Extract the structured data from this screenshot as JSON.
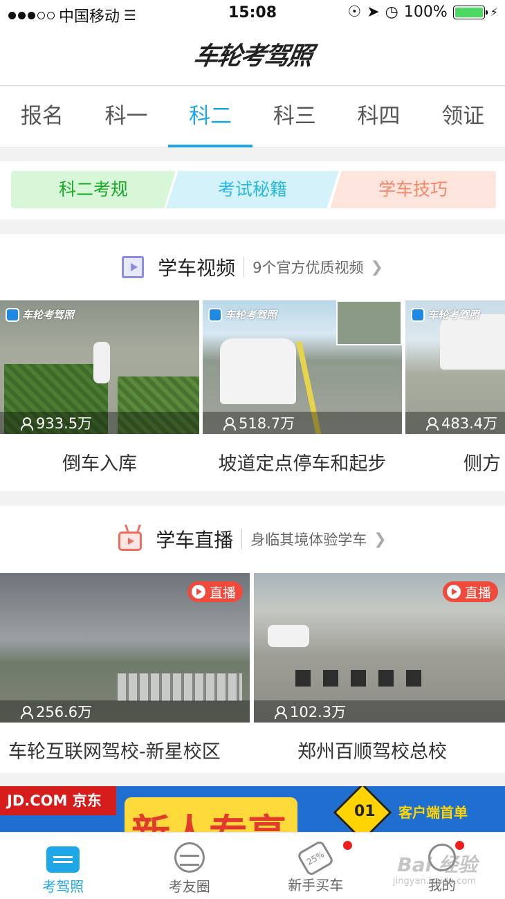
{
  "status_bar": {
    "carrier": "中国移动",
    "time": "15:08",
    "battery": "100%"
  },
  "header": {
    "logo": "车轮考驾照"
  },
  "tabs": [
    {
      "label": "报名"
    },
    {
      "label": "科一"
    },
    {
      "label": "科二",
      "active": true
    },
    {
      "label": "科三"
    },
    {
      "label": "科四"
    },
    {
      "label": "领证"
    }
  ],
  "categories": [
    {
      "label": "科二考规",
      "color": "#1aaa2a"
    },
    {
      "label": "考试秘籍",
      "color": "#2bb8e0"
    },
    {
      "label": "学车技巧",
      "color": "#f08a6a"
    }
  ],
  "video_section": {
    "title": "学车视频",
    "subtitle": "9个官方优质视频",
    "brand_mark": "车轮考驾照",
    "videos": [
      {
        "views": "933.5万",
        "caption": "倒车入库"
      },
      {
        "views": "518.7万",
        "caption": "坡道定点停车和起步"
      },
      {
        "views": "483.4万",
        "caption": "侧方"
      }
    ]
  },
  "live_section": {
    "title": "学车直播",
    "subtitle": "身临其境体验学车",
    "badge": "直播",
    "streams": [
      {
        "views": "256.6万",
        "caption": "车轮互联网驾校-新星校区"
      },
      {
        "views": "102.3万",
        "caption": "郑州百顺驾校总校"
      }
    ]
  },
  "ad": {
    "brand": "JD.COM 京东",
    "headline": "新人专享",
    "event_num": "01",
    "promo": "客户端首单"
  },
  "bottom_nav": [
    {
      "label": "考驾照",
      "active": true
    },
    {
      "label": "考友圈"
    },
    {
      "label": "新手买车",
      "badge": true
    },
    {
      "label": "我的",
      "badge": true
    }
  ],
  "watermark": {
    "text": "Bai 经验",
    "sub": "jingyan.baidu.com"
  },
  "accent_color": "#1ea7e8"
}
